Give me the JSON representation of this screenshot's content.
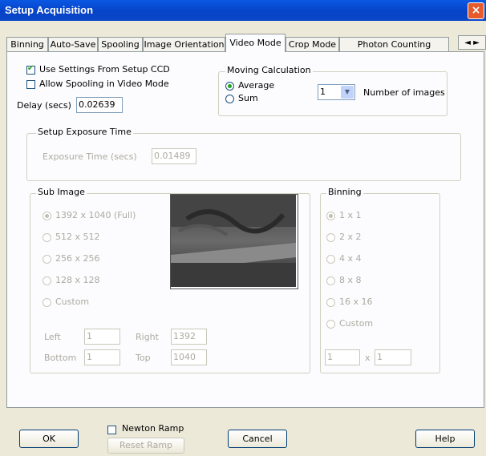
{
  "window": {
    "title": "Setup Acquisition",
    "close_glyph": "×"
  },
  "tabs": [
    {
      "label": "Binning"
    },
    {
      "label": "Auto-Save"
    },
    {
      "label": "Spooling"
    },
    {
      "label": "Image Orientation"
    },
    {
      "label": "Video Mode"
    },
    {
      "label": "Crop Mode"
    },
    {
      "label": "Photon Counting"
    }
  ],
  "tab_scroll": {
    "left": "◄",
    "right": "►"
  },
  "video_mode": {
    "use_settings_label": "Use Settings From Setup CCD",
    "use_settings_checked": true,
    "allow_spooling_label": "Allow Spooling in Video Mode",
    "allow_spooling_checked": false,
    "delay_label": "Delay (secs)",
    "delay_value": "0.02639",
    "moving_calc": {
      "title": "Moving Calculation",
      "average_label": "Average",
      "sum_label": "Sum",
      "selected": "Average",
      "num_images_value": "1",
      "num_images_label": "Number of images"
    }
  },
  "exposure": {
    "title": "Setup Exposure Time",
    "label": "Exposure Time (secs)",
    "value": "0.01489"
  },
  "sub_image": {
    "title": "Sub Image",
    "options": [
      "1392 x 1040 (Full)",
      "512 x 512",
      "256 x 256",
      "128 x 128",
      "Custom"
    ],
    "selected": "1392 x 1040 (Full)",
    "left_label": "Left",
    "left_value": "1",
    "right_label": "Right",
    "right_value": "1392",
    "bottom_label": "Bottom",
    "bottom_value": "1",
    "top_label": "Top",
    "top_value": "1040"
  },
  "binning": {
    "title": "Binning",
    "options": [
      "1 x 1",
      "2 x 2",
      "4 x 4",
      "8 x 8",
      "16 x 16",
      "Custom"
    ],
    "selected": "1 x 1",
    "x_value": "1",
    "separator": "x",
    "y_value": "1"
  },
  "footer": {
    "ok_label": "OK",
    "newton_ramp_label": "Newton Ramp",
    "newton_ramp_checked": false,
    "reset_ramp_label": "Reset Ramp",
    "cancel_label": "Cancel",
    "help_label": "Help"
  },
  "colors": {
    "titlebar": "#0a58e3",
    "dialog_bg": "#ece9d8",
    "panel_bg": "#fcfcfe",
    "check_green": "#21a121"
  }
}
